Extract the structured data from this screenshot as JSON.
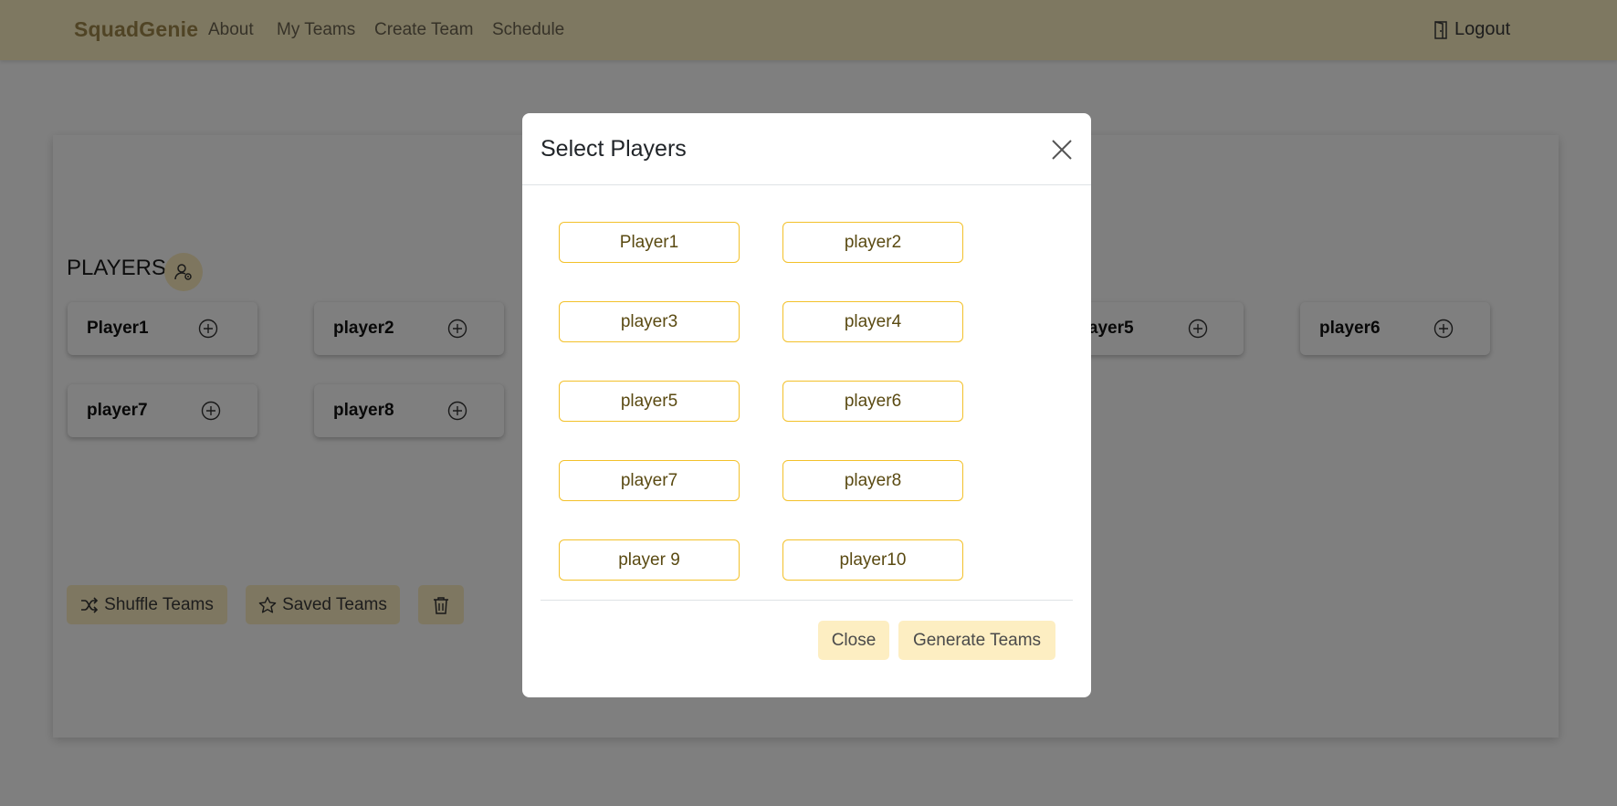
{
  "nav": {
    "brand": "SquadGenie",
    "links": [
      "About",
      "My Teams",
      "Create Team",
      "Schedule"
    ],
    "logout": "Logout"
  },
  "main": {
    "players_heading": "PLAYERS",
    "players": [
      "Player1",
      "player2",
      "player5",
      "player6",
      "player7",
      "player8"
    ],
    "actions": {
      "shuffle": "Shuffle Teams",
      "saved": "Saved Teams"
    }
  },
  "modal": {
    "title": "Select Players",
    "options": [
      "Player1",
      "player2",
      "player3",
      "player4",
      "player5",
      "player6",
      "player7",
      "player8",
      "player 9",
      "player10"
    ],
    "close_label": "Close",
    "generate_label": "Generate Teams"
  },
  "colors": {
    "navbar_bg": "#fdf0c2",
    "accent": "#f3c12a",
    "button_bg": "#fdeec2",
    "brand": "#a1884b"
  },
  "icons": {
    "logout": "door-icon",
    "manage_players": "user-gear-icon",
    "add_player": "plus-circle-icon",
    "shuffle": "shuffle-icon",
    "saved": "star-icon",
    "delete": "trash-icon",
    "modal_close": "close-icon"
  }
}
